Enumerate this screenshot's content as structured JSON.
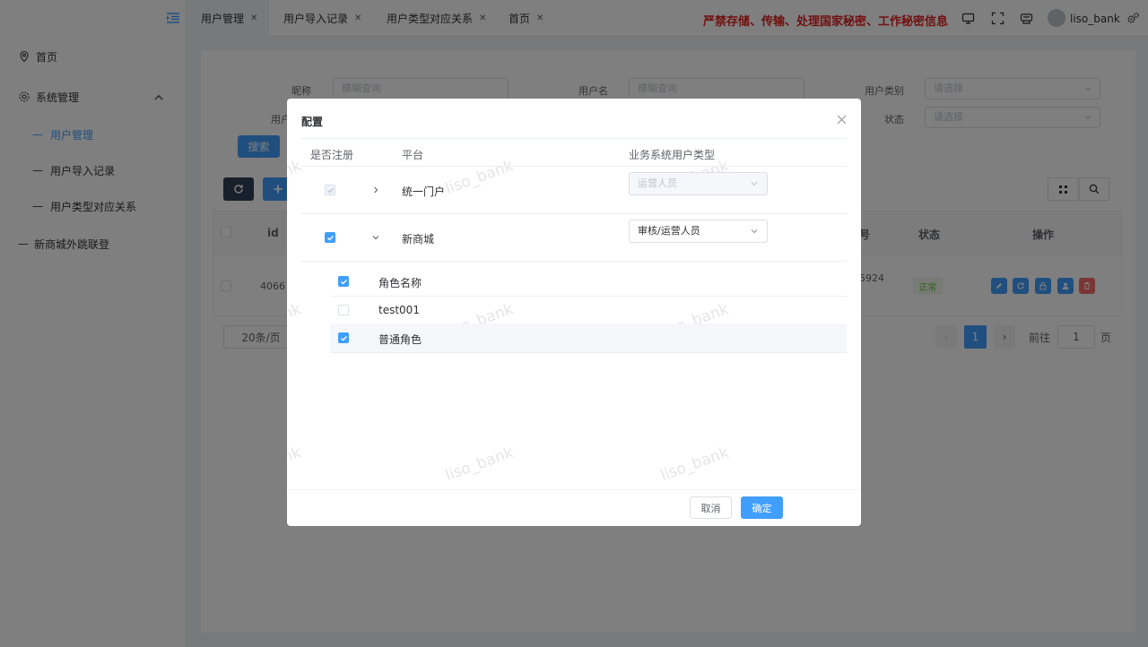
{
  "sidebar": {
    "items": [
      {
        "label": "首页"
      },
      {
        "label": "系统管理"
      },
      {
        "label": "用户管理"
      },
      {
        "label": "用户导入记录"
      },
      {
        "label": "用户类型对应关系"
      },
      {
        "label": "新商城外跳联登"
      }
    ],
    "dash": "—"
  },
  "tabs": [
    {
      "label": "用户管理"
    },
    {
      "label": "用户导入记录"
    },
    {
      "label": "用户类型对应关系"
    },
    {
      "label": "首页"
    }
  ],
  "header": {
    "warning": "严禁存储、传输、处理国家秘密、工作秘密信息",
    "username": "liso_bank"
  },
  "filters": {
    "nickname_label": "昵称",
    "nickname_placeholder": "模糊查询",
    "username_label": "用户名",
    "username_placeholder": "模糊查询",
    "user_type_label": "用户类别",
    "user_type_placeholder": "请选择",
    "row2_label_partial": "用户",
    "status_label": "状态",
    "status_placeholder": "请选择",
    "search_button": "搜索"
  },
  "table": {
    "headers": {
      "id": "id",
      "phone_partial": "号",
      "status": "状态",
      "actions": "操作"
    },
    "row": {
      "id": "4066",
      "phone_partial": "5924",
      "status": "正常"
    }
  },
  "pagination": {
    "page_size": "20条/页",
    "current_page": "1",
    "goto_label": "前往",
    "goto_value": "1",
    "page_suffix": "页"
  },
  "dialog": {
    "title": "配置",
    "headers": {
      "registered": "是否注册",
      "platform": "平台",
      "user_type": "业务系统用户类型"
    },
    "platforms": [
      {
        "name": "统一门户",
        "registered": true,
        "disabled": true,
        "expanded": false,
        "user_type": "运营人员"
      },
      {
        "name": "新商城",
        "registered": true,
        "disabled": false,
        "expanded": true,
        "user_type": "审核/运营人员"
      }
    ],
    "roles": [
      {
        "name": "角色名称",
        "checked": true
      },
      {
        "name": "test001",
        "checked": false
      },
      {
        "name": "普通角色",
        "checked": true
      }
    ],
    "cancel": "取消",
    "confirm": "确定",
    "watermark": "liso_bank",
    "watermark_partial": "nk"
  },
  "colors": {
    "accent": "#409eff",
    "warning": "#e02020",
    "dark": "#304156"
  }
}
